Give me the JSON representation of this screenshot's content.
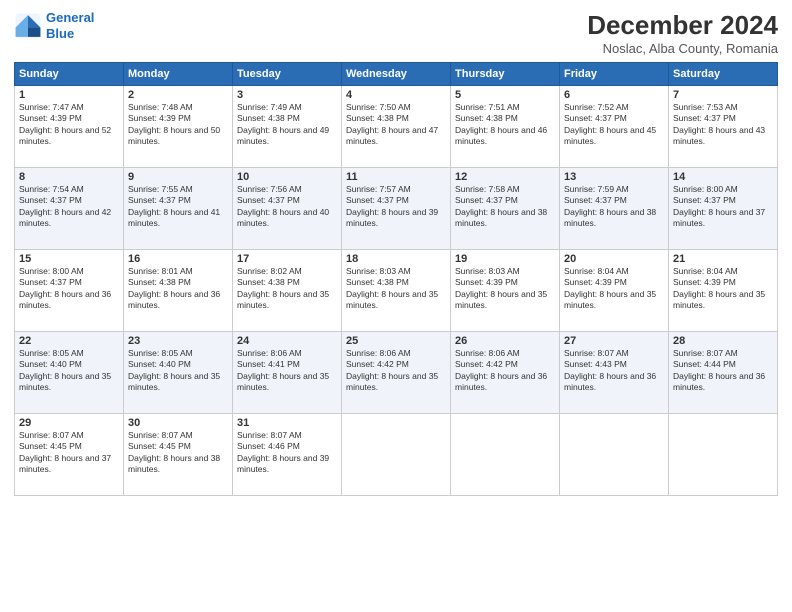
{
  "logo": {
    "line1": "General",
    "line2": "Blue"
  },
  "title": "December 2024",
  "subtitle": "Noslac, Alba County, Romania",
  "days_header": [
    "Sunday",
    "Monday",
    "Tuesday",
    "Wednesday",
    "Thursday",
    "Friday",
    "Saturday"
  ],
  "weeks": [
    [
      {
        "num": "1",
        "rise": "7:47 AM",
        "set": "4:39 PM",
        "daylight": "8 hours and 52 minutes."
      },
      {
        "num": "2",
        "rise": "7:48 AM",
        "set": "4:39 PM",
        "daylight": "8 hours and 50 minutes."
      },
      {
        "num": "3",
        "rise": "7:49 AM",
        "set": "4:38 PM",
        "daylight": "8 hours and 49 minutes."
      },
      {
        "num": "4",
        "rise": "7:50 AM",
        "set": "4:38 PM",
        "daylight": "8 hours and 47 minutes."
      },
      {
        "num": "5",
        "rise": "7:51 AM",
        "set": "4:38 PM",
        "daylight": "8 hours and 46 minutes."
      },
      {
        "num": "6",
        "rise": "7:52 AM",
        "set": "4:37 PM",
        "daylight": "8 hours and 45 minutes."
      },
      {
        "num": "7",
        "rise": "7:53 AM",
        "set": "4:37 PM",
        "daylight": "8 hours and 43 minutes."
      }
    ],
    [
      {
        "num": "8",
        "rise": "7:54 AM",
        "set": "4:37 PM",
        "daylight": "8 hours and 42 minutes."
      },
      {
        "num": "9",
        "rise": "7:55 AM",
        "set": "4:37 PM",
        "daylight": "8 hours and 41 minutes."
      },
      {
        "num": "10",
        "rise": "7:56 AM",
        "set": "4:37 PM",
        "daylight": "8 hours and 40 minutes."
      },
      {
        "num": "11",
        "rise": "7:57 AM",
        "set": "4:37 PM",
        "daylight": "8 hours and 39 minutes."
      },
      {
        "num": "12",
        "rise": "7:58 AM",
        "set": "4:37 PM",
        "daylight": "8 hours and 38 minutes."
      },
      {
        "num": "13",
        "rise": "7:59 AM",
        "set": "4:37 PM",
        "daylight": "8 hours and 38 minutes."
      },
      {
        "num": "14",
        "rise": "8:00 AM",
        "set": "4:37 PM",
        "daylight": "8 hours and 37 minutes."
      }
    ],
    [
      {
        "num": "15",
        "rise": "8:00 AM",
        "set": "4:37 PM",
        "daylight": "8 hours and 36 minutes."
      },
      {
        "num": "16",
        "rise": "8:01 AM",
        "set": "4:38 PM",
        "daylight": "8 hours and 36 minutes."
      },
      {
        "num": "17",
        "rise": "8:02 AM",
        "set": "4:38 PM",
        "daylight": "8 hours and 35 minutes."
      },
      {
        "num": "18",
        "rise": "8:03 AM",
        "set": "4:38 PM",
        "daylight": "8 hours and 35 minutes."
      },
      {
        "num": "19",
        "rise": "8:03 AM",
        "set": "4:39 PM",
        "daylight": "8 hours and 35 minutes."
      },
      {
        "num": "20",
        "rise": "8:04 AM",
        "set": "4:39 PM",
        "daylight": "8 hours and 35 minutes."
      },
      {
        "num": "21",
        "rise": "8:04 AM",
        "set": "4:39 PM",
        "daylight": "8 hours and 35 minutes."
      }
    ],
    [
      {
        "num": "22",
        "rise": "8:05 AM",
        "set": "4:40 PM",
        "daylight": "8 hours and 35 minutes."
      },
      {
        "num": "23",
        "rise": "8:05 AM",
        "set": "4:40 PM",
        "daylight": "8 hours and 35 minutes."
      },
      {
        "num": "24",
        "rise": "8:06 AM",
        "set": "4:41 PM",
        "daylight": "8 hours and 35 minutes."
      },
      {
        "num": "25",
        "rise": "8:06 AM",
        "set": "4:42 PM",
        "daylight": "8 hours and 35 minutes."
      },
      {
        "num": "26",
        "rise": "8:06 AM",
        "set": "4:42 PM",
        "daylight": "8 hours and 36 minutes."
      },
      {
        "num": "27",
        "rise": "8:07 AM",
        "set": "4:43 PM",
        "daylight": "8 hours and 36 minutes."
      },
      {
        "num": "28",
        "rise": "8:07 AM",
        "set": "4:44 PM",
        "daylight": "8 hours and 36 minutes."
      }
    ],
    [
      {
        "num": "29",
        "rise": "8:07 AM",
        "set": "4:45 PM",
        "daylight": "8 hours and 37 minutes."
      },
      {
        "num": "30",
        "rise": "8:07 AM",
        "set": "4:45 PM",
        "daylight": "8 hours and 38 minutes."
      },
      {
        "num": "31",
        "rise": "8:07 AM",
        "set": "4:46 PM",
        "daylight": "8 hours and 39 minutes."
      },
      null,
      null,
      null,
      null
    ]
  ]
}
